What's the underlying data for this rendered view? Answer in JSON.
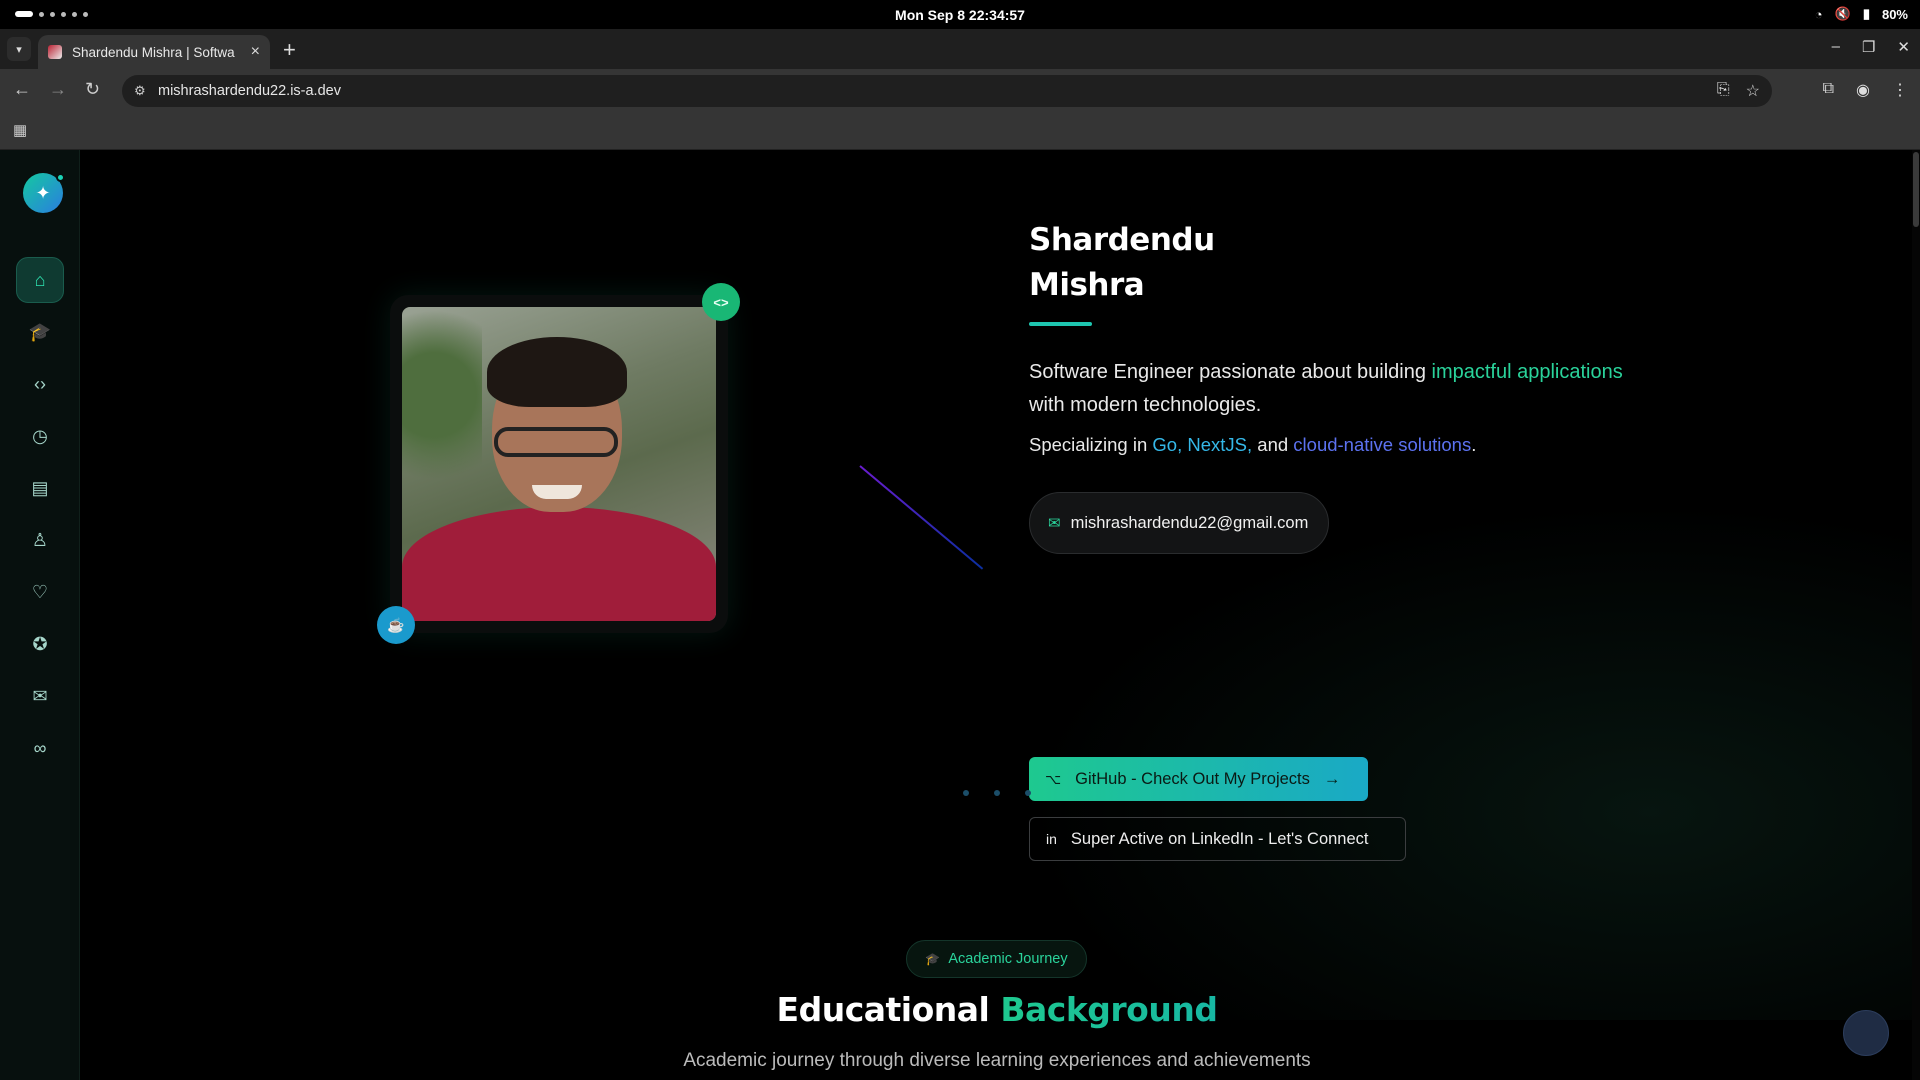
{
  "os": {
    "datetime": "Mon Sep 8  22:34:57",
    "battery": "80%"
  },
  "browser": {
    "tab_title": "Shardendu Mishra | Softwa",
    "url": "mishrashardendu22.is-a.dev"
  },
  "hero": {
    "name_first": "Shardendu",
    "name_last": "Mishra",
    "lead_1": "Software Engineer passionate about building ",
    "lead_accent": "impactful applications",
    "lead_2": " with modern technologies.",
    "spec_1": "Specializing in ",
    "spec_go": "Go, NextJS,",
    "spec_and": " and ",
    "spec_cloud": "cloud-native solutions",
    "spec_end": ".",
    "email": "mishrashardendu22@gmail.com",
    "github_label": "GitHub - Check Out My Projects",
    "linkedin_label": "Super Active on LinkedIn - Let's Connect"
  },
  "education": {
    "chip": "Academic Journey",
    "title_1": "Educational ",
    "title_2": "Background",
    "subtitle": "Academic journey through diverse learning experiences and achievements"
  },
  "sidebar": {
    "items": [
      "home-icon",
      "graduation-cap-icon",
      "code-icon",
      "clock-icon",
      "briefcase-icon",
      "user-icon",
      "heart-icon",
      "award-icon",
      "mail-icon",
      "glasses-icon"
    ]
  },
  "colors": {
    "accent_green": "#2ad39b",
    "accent_blue": "#35b8e8",
    "accent_violet": "#5c72f0"
  }
}
